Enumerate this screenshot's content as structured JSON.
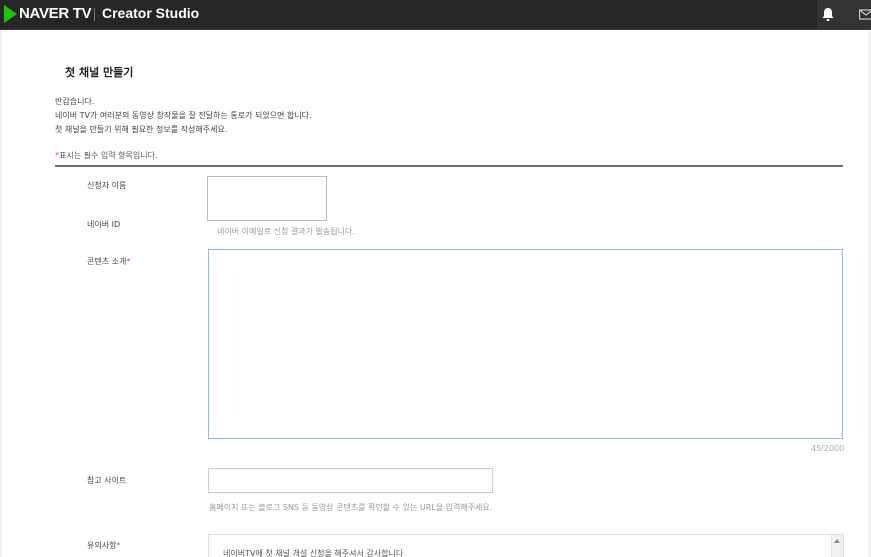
{
  "header": {
    "brand": "NAVER TV",
    "studio": "Creator Studio"
  },
  "icons": {
    "bell": "bell-icon",
    "mail": "mail-icon"
  },
  "colors": {
    "brand_green": "#1ec800",
    "required": "#e84545",
    "focus_border": "#8fb8e8"
  },
  "page": {
    "title": "첫 채널 만들기",
    "intro": [
      "반갑습니다.",
      "네이버 TV가 여러분의 동영상 창작물을 잘 전달하는 통로가 되었으면 합니다.",
      "첫 채널을 만들기 위해 필요한 정보를 작성해주세요."
    ],
    "required_star": "*",
    "required_note": "표시는 필수 입력 항목입니다."
  },
  "form": {
    "applicant_label": "신청자 이름",
    "naver_id_label": "네이버 ID",
    "naver_id_hint": "네이버 이메일로 신청 결과가 발송됩니다.",
    "content_label": "콘텐츠 소개",
    "content_value": "",
    "content_counter": "45/2000",
    "ref_label": "참고 사이트",
    "ref_value": "",
    "ref_hint": "홈페이지 또는 블로그 SNS 등 동영상 콘텐츠를 확인할 수 있는 URL을 입력해주세요.",
    "notice_label": "유의사항",
    "notice_text": "네이버TV에 첫 채널 개설 신청을 해주셔서 감사합니다"
  }
}
